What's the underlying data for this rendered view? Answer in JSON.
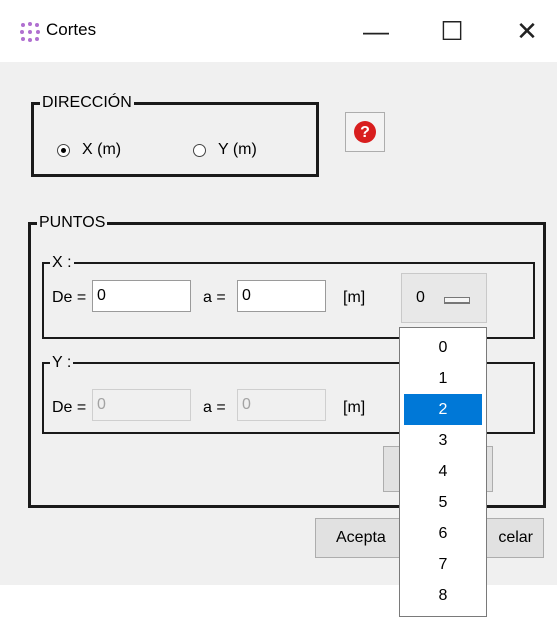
{
  "window": {
    "title": "Cortes"
  },
  "titlebar": {
    "minimize": "—",
    "maximize": "☐",
    "close": "✕"
  },
  "direccion": {
    "legend": "DIRECCIÓN",
    "options": [
      "X (m)",
      "Y (m)"
    ],
    "selected": "X (m)"
  },
  "help": {
    "icon": "question-icon"
  },
  "puntos": {
    "legend": "PUNTOS",
    "x": {
      "legend": "X :",
      "de_label": "De =",
      "de_value": "0",
      "a_label": "a =",
      "a_value": "0",
      "unit": "[m]",
      "combo_value": "0"
    },
    "y": {
      "legend": "Y :",
      "de_label": "De =",
      "de_value": "0",
      "a_label": "a =",
      "a_value": "0",
      "unit": "[m]"
    }
  },
  "dropdown": {
    "options": [
      "0",
      "1",
      "2",
      "3",
      "4",
      "5",
      "6",
      "7",
      "8"
    ],
    "selected": "2"
  },
  "buttons": {
    "accept_visible": "Acepta",
    "cancel_visible": "celar"
  },
  "colors": {
    "selection": "#0078d7",
    "help_icon": "#d81e1e"
  }
}
